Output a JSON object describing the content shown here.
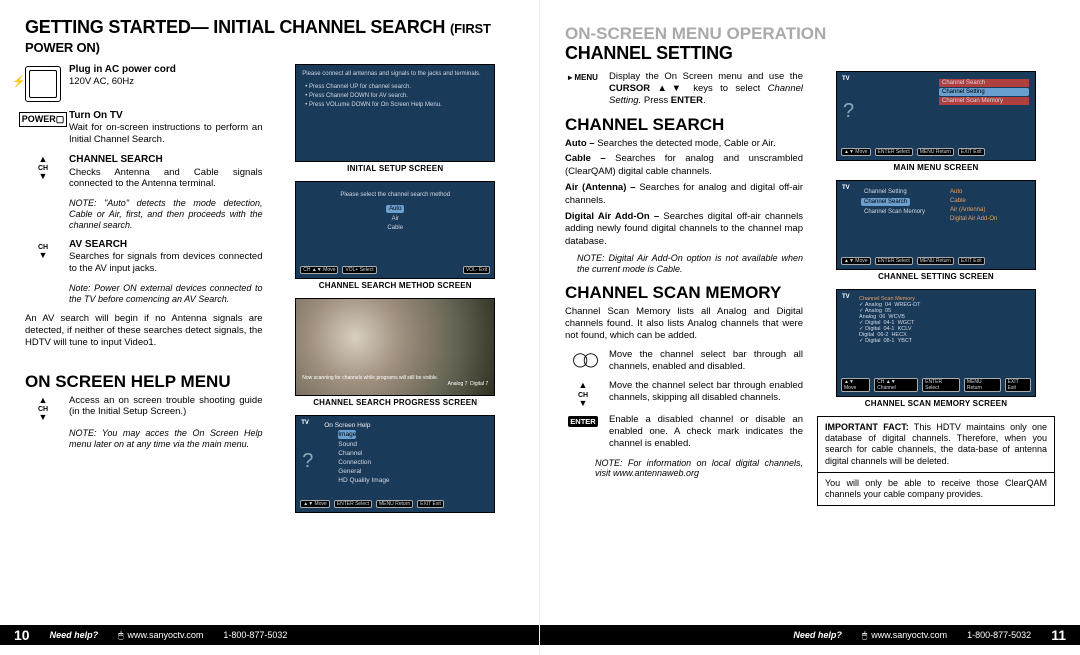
{
  "left": {
    "title": "GETTING STARTED— INITIAL CHANNEL SEARCH",
    "title_sub": "(FIRST POWER ON)",
    "plug_title": "Plug in AC power cord",
    "plug_sub": "120V AC, 60Hz",
    "turn_on_title": "Turn On TV",
    "turn_on_body": "Wait for on-screen instructions to perform an Initial Channel Search.",
    "ch_search_title": "CHANNEL SEARCH",
    "ch_search_body": "Checks Antenna and Cable signals connected to the Antenna terminal.",
    "ch_search_note": "NOTE: \"Auto\" detects the mode detection, Cable or Air, first, and then proceeds with the channel search.",
    "av_search_title": "AV SEARCH",
    "av_search_body": "Searches for signals from devices connected to the AV input jacks.",
    "av_search_note": "Note: Power ON external devices connected to the TV before comencing an AV Search.",
    "av_para": "An AV search will begin if no Antenna signals are detected, if neither of these searches detect signals, the HDTV will tune to input Video1.",
    "help_title": "ON SCREEN HELP MENU",
    "help_body": "Access an on screen trouble shooting guide (in the Initial Setup Screen.)",
    "help_note": "NOTE: You may acces the On Screen Help menu later on at any time via the main menu.",
    "cap_initial": "INITIAL SETUP SCREEN",
    "cap_method": "CHANNEL SEARCH METHOD SCREEN",
    "cap_progress": "CHANNEL SEARCH PROGRESS SCREEN",
    "help_screen_items": [
      "Image",
      "Sound",
      "Channel",
      "Connection",
      "General",
      "HD Quality Image"
    ],
    "help_screen_hdr": "On Screen Help",
    "footer_page": "10",
    "footer_need": "Need help?",
    "footer_url": "www.sanyoctv.com",
    "footer_phone": "1-800-877-5032"
  },
  "right": {
    "pre_title": "ON-SCREEN MENU OPERATION",
    "title": "CHANNEL SETTING",
    "menu_body_a": "Display the On Screen menu and use the ",
    "menu_body_b": "CURSOR ▲▼",
    "menu_body_c": " keys to select ",
    "menu_body_d": "Channel Setting.",
    "menu_body_e": " Press ",
    "menu_body_f": "ENTER",
    "menu_body_g": ".",
    "ch_search_title": "CHANNEL SEARCH",
    "auto_l": "Auto –",
    "auto_b": " Searches the detected mode, Cable or Air.",
    "cable_l": "Cable –",
    "cable_b": " Searches for analog and unscrambled (ClearQAM) digital cable channels.",
    "air_l": "Air (Antenna) –",
    "air_b": " Searches for analog and digital off-air channels.",
    "addon_l": "Digital Air Add-On –",
    "addon_b": " Searches digital off-air channels adding newly found digital channels to the channel map database.",
    "addon_note": "NOTE: Digital Air Add-On option is not available when the current mode is Cable.",
    "scanmem_title": "CHANNEL SCAN MEMORY",
    "scanmem_intro": "Channel Scan Memory lists all Analog and Digital channels found. It also lists Analog channels that were not found, which can be added.",
    "eyes1": "Move the channel select bar through all channels, enabled and disabled.",
    "eyes2": "Move the channel select bar through enabled channels, skipping all disabled channels.",
    "enter_body": "Enable a disabled channel or disable an enabled one. A check mark indicates the channel is enabled.",
    "scan_note": "NOTE: For information on local digital channels, visit www.antennaweb.org",
    "cap_main": "MAIN MENU SCREEN",
    "cap_setting": "CHANNEL SETTING SCREEN",
    "cap_scanmem": "CHANNEL SCAN MEMORY SCREEN",
    "main_items": [
      "Channel Search",
      "Channel Setting",
      "Channel Scan Memory"
    ],
    "setting_left": [
      "Channel Setting",
      "Channel Search",
      "Channel Scan Memory"
    ],
    "setting_right": [
      "Auto",
      "Cable",
      "Air (Antenna)",
      "Digital Air Add-On"
    ],
    "scanmem_rows": [
      [
        "✓ Analog",
        "04",
        "WREG-DT"
      ],
      [
        "✓ Analog",
        "05",
        ""
      ],
      [
        "  Analog",
        "06",
        "WCVB"
      ],
      [
        "✓ Digital",
        "04-1",
        "WGCT"
      ],
      [
        "✓ Digital",
        "04-1",
        "KCLV"
      ],
      [
        "  Digital",
        "06-2",
        "HECX"
      ],
      [
        "✓ Digital",
        "08-1",
        "YBCT"
      ]
    ],
    "fact1_lead": "IMPORTANT FACT:",
    "fact1_body": " This HDTV maintains only one database of digital channels. Therefore, when you search for cable channels, the data-base of antenna digital channels will be deleted.",
    "fact2": "You will only be able to receive those ClearQAM channels your cable company provides.",
    "footer_page": "11",
    "footer_need": "Need help?",
    "footer_url": "www.sanyoctv.com",
    "footer_phone": "1-800-877-5032"
  }
}
